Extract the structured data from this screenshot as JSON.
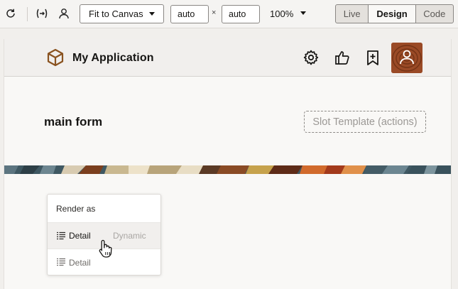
{
  "toolbar": {
    "refresh_icon": "refresh-icon",
    "variable_icon": "variable-icon",
    "user_icon": "user-icon",
    "fit_select": {
      "value": "Fit to Canvas",
      "icon": "chevron-down-icon"
    },
    "width_value": "auto",
    "times_symbol": "×",
    "height_value": "auto",
    "zoom": "100%",
    "modes": [
      {
        "label": "Live",
        "active": false
      },
      {
        "label": "Design",
        "active": true
      },
      {
        "label": "Code",
        "active": false
      }
    ]
  },
  "app": {
    "title": "My Application",
    "logo_icon": "cube-logo-icon",
    "header_icons": [
      "gear-icon",
      "thumbs-up-icon",
      "bookmark-plus-icon"
    ],
    "avatar": "avatar"
  },
  "main": {
    "form_title": "main form",
    "slot_label": "Slot Template (actions)"
  },
  "popup": {
    "header": "Render as",
    "options": [
      {
        "label": "Detail",
        "hint": "Dynamic",
        "icon": "list-detail-icon",
        "hovered": true
      },
      {
        "label": "Detail",
        "hint": "",
        "icon": "list-detail-icon",
        "hovered": false
      }
    ]
  },
  "colors": {
    "toolbar_bg": "#f5f4f2",
    "canvas_bg": "#f9f8f6",
    "header_bg": "#f1efed",
    "logo": "#8a5320",
    "avatar": "#9a4a26",
    "slot_border": "#8d8a87"
  }
}
